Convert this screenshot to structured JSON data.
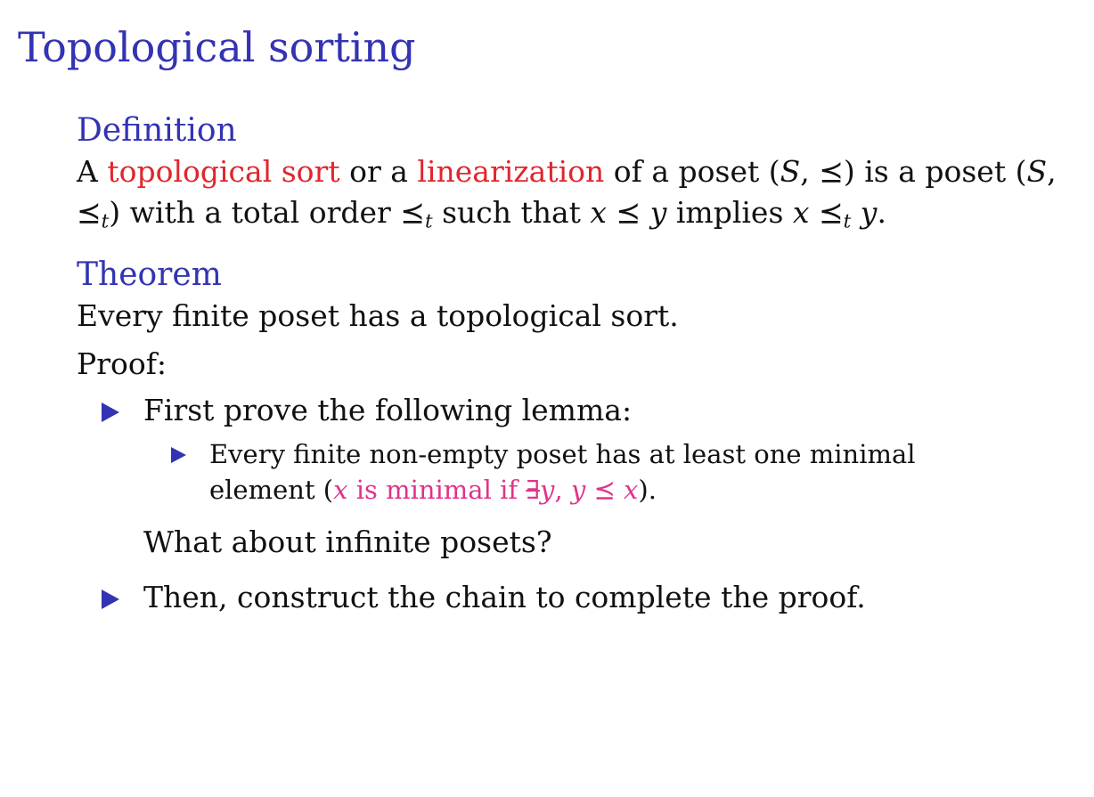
{
  "slide": {
    "title": "Topological sorting"
  },
  "definition": {
    "heading": "Definition",
    "part1": "A ",
    "term1": "topological sort",
    "part2": " or a ",
    "term2": "linearization",
    "part3": " of a poset (",
    "part4": ") is a poset (",
    "part5": ") with a total order ",
    "part6": " such that ",
    "part7": " implies ",
    "var_S": "S",
    "var_x": "x",
    "var_y": "y",
    "sym_prec": "⪯",
    "sub_t": "t",
    "comma": ", ",
    "period": "."
  },
  "theorem": {
    "heading": "Theorem",
    "statement": "Every finite poset has a topological sort."
  },
  "proof": {
    "label": "Proof:",
    "bullet1": "First prove the following lemma:",
    "sub_bullet": "Every finite non-empty poset has at least one minimal element (",
    "sub_x": "x",
    "sub_is_minimal": " is minimal if ",
    "sub_exists": "∃",
    "sub_y": "y",
    "sub_comma": ", ",
    "sub_close": ").",
    "question": "What about infinite posets?",
    "bullet2": "Then, construct the chain to complete the proof."
  },
  "colors": {
    "heading": "#3333b3",
    "term": "#e0262d",
    "highlight": "#e0338a"
  },
  "icons": {
    "bullet": "triangle-right-icon"
  }
}
